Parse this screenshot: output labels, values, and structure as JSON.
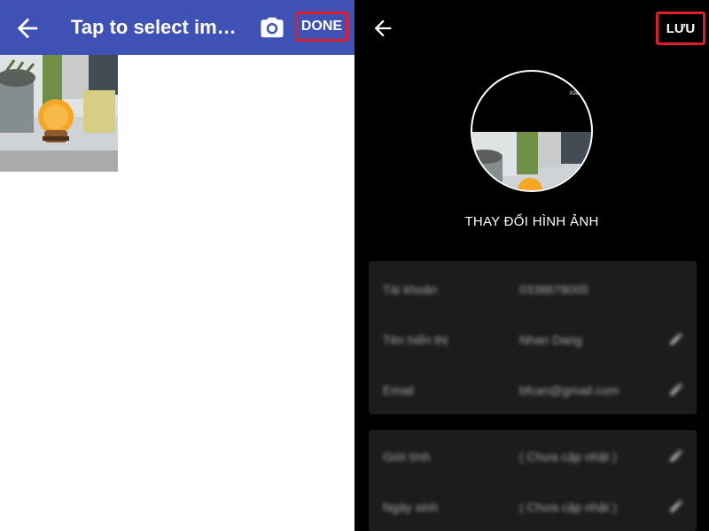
{
  "left_screen": {
    "title": "Tap to select images",
    "done_label": "DONE",
    "icons": {
      "back": "arrow-left-icon",
      "camera": "camera-icon"
    },
    "colors": {
      "appbar": "#3f51b5",
      "highlight": "#e11d2a"
    }
  },
  "right_screen": {
    "save_label": "LƯU",
    "avatar_tag": "Xóa N",
    "change_photo_label": "THAY ĐỔI HÌNH ẢNH",
    "account_section": [
      {
        "label": "Tài khoản",
        "value": "0338678005",
        "editable": false
      },
      {
        "label": "Tên hiển thị",
        "value": "Nhan Dang",
        "editable": true
      },
      {
        "label": "Email",
        "value": "bfcan@gmail.com",
        "editable": true
      }
    ],
    "profile_section": [
      {
        "label": "Giới tính",
        "value": "( Chưa cập nhật )",
        "editable": true
      },
      {
        "label": "Ngày sinh",
        "value": "( Chưa cập nhật )",
        "editable": true
      }
    ]
  }
}
